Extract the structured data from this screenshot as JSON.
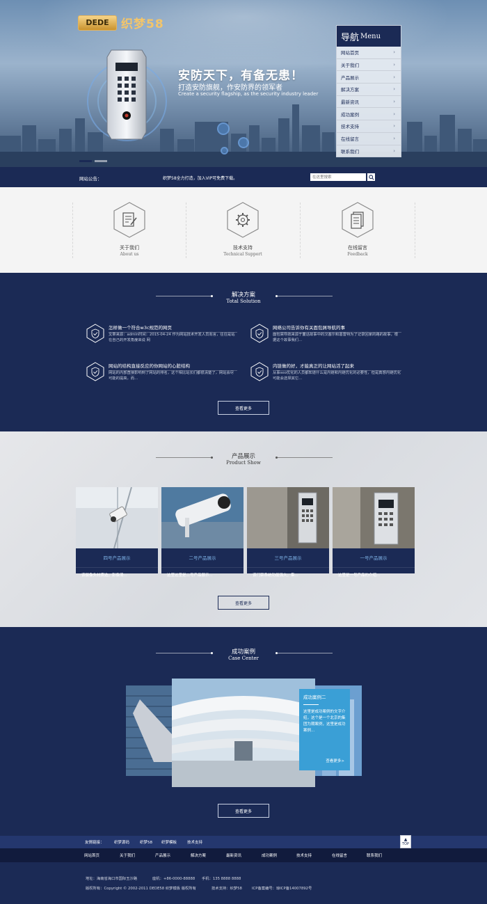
{
  "brand": {
    "logo_mark": "DEDE",
    "logo_text": "织梦58"
  },
  "hero": {
    "title": "安防天下，有备无患！",
    "subtitle": "打造安防旗舰，作安防界的领军者",
    "subtitle_en": "Create a security flagship, as the security industry leader"
  },
  "side_menu": {
    "title": "导航",
    "title_en": "Menu",
    "items": [
      {
        "label": "网站首页"
      },
      {
        "label": "关于我们"
      },
      {
        "label": "产品展示"
      },
      {
        "label": "解决方案"
      },
      {
        "label": "最新资讯"
      },
      {
        "label": "成功案例"
      },
      {
        "label": "技术支持"
      },
      {
        "label": "在线留言"
      },
      {
        "label": "联系我们"
      }
    ]
  },
  "notice": {
    "label": "网站公告：",
    "message": "织梦58全力打造，加入VIP可免费下载。",
    "search_placeholder": "在这里搜索"
  },
  "features": [
    {
      "cn": "关于我们",
      "en": "About us",
      "icon": "document-edit-icon"
    },
    {
      "cn": "技术支持",
      "en": "Technical Support",
      "icon": "gear-icon"
    },
    {
      "cn": "在线留言",
      "en": "Feedback",
      "icon": "message-document-icon"
    }
  ],
  "solutions": {
    "title": "解决方案",
    "title_en": "Total Solution",
    "more": "查看更多",
    "items": [
      {
        "title": "怎样做一个符合w3c规范的网页",
        "desc": "文章来源：admin时间：2015-04-24 作为网站技术开发人员而言，往往是站在自己的开发角度来说 网"
      },
      {
        "title": "网络公司告诉你有关面包屑导航的事",
        "desc": "面包屑导航来源于童话故事中的汉塞尔和葛雷特为了记录回家的路的故事，根据这个故事我们..."
      },
      {
        "title": "网站的结构直接反应的你网站的心脏结构",
        "desc": "网站的内部直接影响到了网站的排名，这个相比站长们都很清楚了，网站会尽可能的提高，而..."
      },
      {
        "title": "内链做的好，才能真正的让网站活了起来",
        "desc": "从事seo优化的人员都知道什么是内链和内链优化的必要性，但是真想内链优化可能会选择其它..."
      }
    ]
  },
  "products": {
    "title": "产品展示",
    "title_en": "Product Show",
    "more": "查看更多",
    "items": [
      {
        "name": "四号产品展示",
        "desc": "该摄像头材质选，影像清..."
      },
      {
        "name": "二号产品展示",
        "desc": "这里这里是二号产品展示..."
      },
      {
        "name": "三号产品展示",
        "desc": "该门禁系统功能强大，集..."
      },
      {
        "name": "一号产品展示",
        "desc": "这里是一号产品的介绍..."
      }
    ]
  },
  "cases": {
    "title": "成功案例",
    "title_en": "Case Center",
    "more": "查看更多",
    "featured": {
      "title": "成功案例二",
      "desc": "这里是成功案例的文字介绍，这个是一个北京的集团为期案例，这里是成功案例...",
      "more": "查看更多>"
    }
  },
  "footer": {
    "friend_label": "友情链接：",
    "friend_links": [
      "织梦源码",
      "织梦58",
      "织梦模板",
      "技术支持"
    ],
    "top_label": "TOP",
    "nav": [
      "网站首页",
      "关于我们",
      "产品展示",
      "解决方案",
      "最新资讯",
      "成功案例",
      "技术支持",
      "在线留言",
      "联系我们"
    ],
    "address": "地址：海南省海口市国际玉沙路",
    "phone": "座机：+86-0000-88888",
    "mobile": "手机：135 8888 8888",
    "copyright": "版权所有：Copyright © 2002-2011 DEDE58 织梦模板 版权所有",
    "support": "技术支持：织梦58",
    "icp": "ICP备案编号：琼ICP备14007892号"
  },
  "colors": {
    "navy": "#1b2a55",
    "accent_blue": "#3a9fd6",
    "gold": "#f3c56a"
  }
}
